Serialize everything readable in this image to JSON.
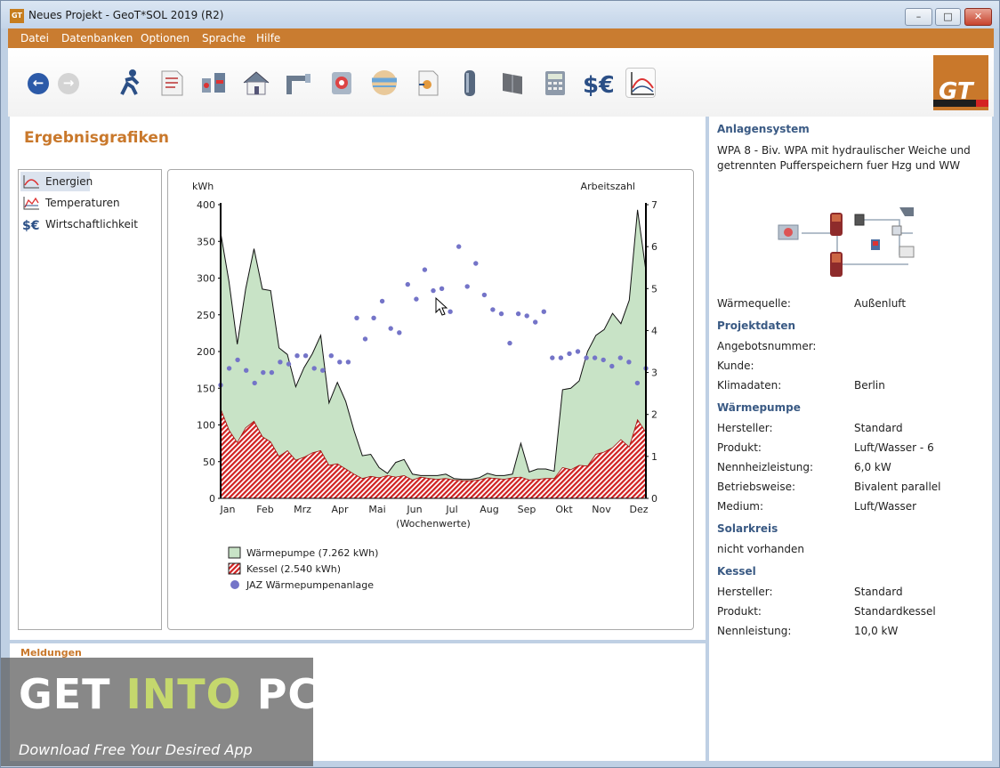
{
  "window": {
    "title": "Neues Projekt - GeoT*SOL 2019 (R2)",
    "app_badge": "GT"
  },
  "menu": [
    "Datei",
    "Datenbanken",
    "Optionen",
    "Sprache",
    "Hilfe"
  ],
  "logo_text": "GT",
  "page_title": "Ergebnisgrafiken",
  "nav": [
    {
      "label": "Energien",
      "selected": true
    },
    {
      "label": "Temperaturen",
      "selected": false
    },
    {
      "label": "Wirtschaftlichkeit",
      "selected": false
    }
  ],
  "chart_data": {
    "type": "area",
    "ylabel_left": "kWh",
    "ylabel_right": "Arbeitszahl",
    "xlabel": "(Wochenwerte)",
    "ylim_left": [
      0,
      400
    ],
    "ylim_right": [
      0,
      7
    ],
    "yticks_left": [
      "0",
      "50",
      "100",
      "150",
      "200",
      "250",
      "300",
      "350",
      "400"
    ],
    "yticks_right": [
      "0",
      "1",
      "2",
      "3",
      "4",
      "5",
      "6",
      "7"
    ],
    "categories": [
      "Jan",
      "Feb",
      "Mrz",
      "Apr",
      "Mai",
      "Jun",
      "Jul",
      "Aug",
      "Sep",
      "Okt",
      "Nov",
      "Dez"
    ],
    "legend_placement": "bottom",
    "series": [
      {
        "name": "Wärmepumpe (7.262 kWh)",
        "kind": "area-total",
        "color": "#c8e3c6",
        "values": [
          362,
          295,
          210,
          285,
          340,
          285,
          283,
          205,
          196,
          152,
          178,
          197,
          222,
          130,
          158,
          132,
          92,
          58,
          60,
          42,
          34,
          49,
          53,
          33,
          31,
          31,
          31,
          33,
          27,
          26,
          26,
          28,
          34,
          31,
          31,
          33,
          75,
          36,
          40,
          40,
          37,
          148,
          150,
          160,
          200,
          222,
          230,
          252,
          238,
          270,
          393,
          310
        ]
      },
      {
        "name": "Kessel (2.540 kWh)",
        "kind": "area",
        "color": "#d02020",
        "values": [
          122,
          93,
          76,
          96,
          105,
          84,
          77,
          57,
          65,
          52,
          56,
          62,
          65,
          45,
          47,
          40,
          33,
          27,
          30,
          28,
          31,
          29,
          31,
          25,
          29,
          27,
          26,
          27,
          25,
          24,
          24,
          25,
          28,
          27,
          26,
          28,
          29,
          25,
          26,
          27,
          27,
          42,
          39,
          45,
          44,
          60,
          63,
          69,
          80,
          70,
          107,
          90
        ]
      },
      {
        "name": "JAZ Wärmepumpenanlage",
        "kind": "scatter",
        "color": "#7474c8",
        "values": [
          2.7,
          3.1,
          3.3,
          3.05,
          2.75,
          3.0,
          3.0,
          3.25,
          3.2,
          3.4,
          3.4,
          3.1,
          3.05,
          3.4,
          3.25,
          3.25,
          4.3,
          3.8,
          4.3,
          4.7,
          4.05,
          3.95,
          5.1,
          4.75,
          5.45,
          4.95,
          5.0,
          4.45,
          6.0,
          5.05,
          5.6,
          4.85,
          4.5,
          4.4,
          3.7,
          4.4,
          4.35,
          4.2,
          4.45,
          3.35,
          3.35,
          3.45,
          3.5,
          3.35,
          3.35,
          3.3,
          3.15,
          3.35,
          3.25,
          2.75,
          3.1
        ]
      }
    ]
  },
  "messages_title": "Meldungen",
  "system": {
    "heading": "Anlagensystem",
    "description_lines": [
      "WPA 8 - Biv. WPA mit hydraulischer Weiche und",
      "getrennten Pufferspeichern fuer Hzg und WW"
    ],
    "waermequelle_label": "Wärmequelle:",
    "waermequelle_value": "Außenluft"
  },
  "project": {
    "heading": "Projektdaten",
    "angebot_label": "Angebotsnummer:",
    "kunde_label": "Kunde:",
    "klima_label": "Klimadaten:",
    "klima_value": "Berlin"
  },
  "heatpump": {
    "heading": "Wärmepumpe",
    "rows": [
      {
        "label": "Hersteller:",
        "value": "Standard"
      },
      {
        "label": "Produkt:",
        "value": "Luft/Wasser -  6"
      },
      {
        "label": "Nennheizleistung:",
        "value": "6,0 kW"
      },
      {
        "label": "Betriebsweise:",
        "value": "Bivalent parallel"
      },
      {
        "label": "Medium:",
        "value": "Luft/Wasser"
      }
    ]
  },
  "solar": {
    "heading": "Solarkreis",
    "value": "nicht vorhanden"
  },
  "boiler": {
    "heading": "Kessel",
    "rows": [
      {
        "label": "Hersteller:",
        "value": "Standard"
      },
      {
        "label": "Produkt:",
        "value": "Standardkessel"
      },
      {
        "label": "Nennleistung:",
        "value": "10,0 kW"
      }
    ]
  },
  "watermark": {
    "part1": "GET ",
    "part2": "INTO",
    "part3": " PC",
    "tagline": "Download Free Your Desired App"
  }
}
